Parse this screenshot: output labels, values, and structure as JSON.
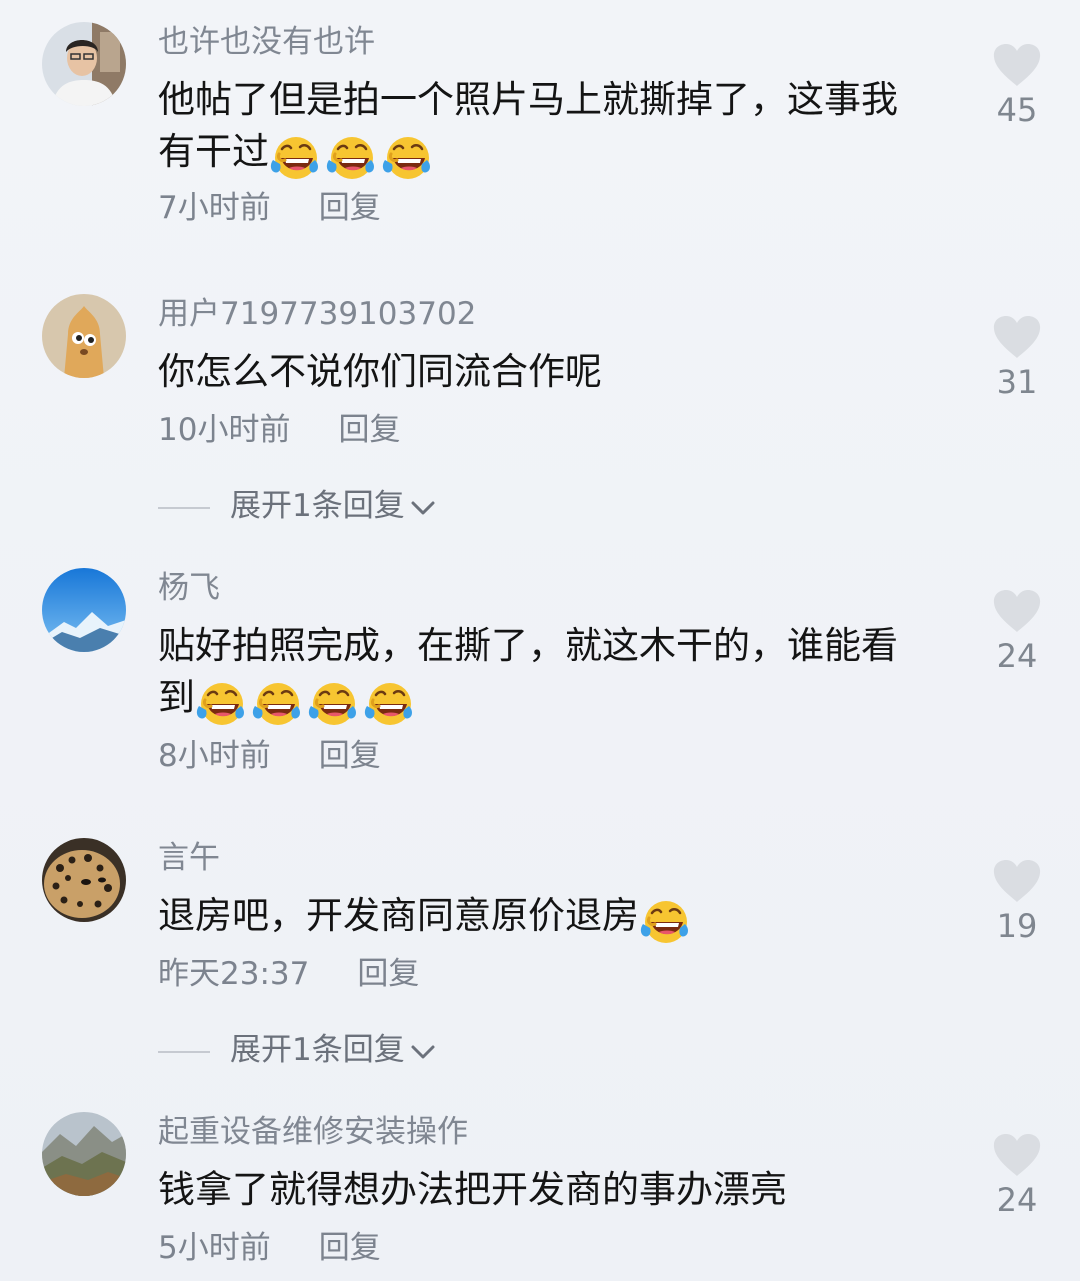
{
  "comments": [
    {
      "username": "也许也没有也许",
      "text_lines": [
        "他帖了但是拍一个照片马上就撕掉了，这事我",
        "有干过"
      ],
      "emoji_count": 3,
      "time": "7小时前",
      "reply_label": "回复",
      "likes": "45",
      "avatar_icon": "person-photo-avatar",
      "emoji_icon": "laughing-tears-emoji"
    },
    {
      "username": "用户7197739103702",
      "text_lines": [
        "你怎么不说你们同流合作呢"
      ],
      "emoji_count": 0,
      "time": "10小时前",
      "reply_label": "回复",
      "likes": "31",
      "expand_label": "展开1条回复",
      "avatar_icon": "cartoon-character-avatar"
    },
    {
      "username": "杨飞",
      "text_lines": [
        "贴好拍照完成，在撕了，就这木干的，谁能看",
        "到"
      ],
      "emoji_count": 4,
      "time": "8小时前",
      "reply_label": "回复",
      "likes": "24",
      "avatar_icon": "snow-mountain-avatar",
      "emoji_icon": "laughing-tears-emoji"
    },
    {
      "username": "言午",
      "text_lines": [
        "退房吧，开发商同意原价退房"
      ],
      "emoji_count": 1,
      "time": "昨天23:37",
      "reply_label": "回复",
      "likes": "19",
      "expand_label": "展开1条回复",
      "avatar_icon": "leopard-avatar",
      "emoji_icon": "laughing-tears-emoji"
    },
    {
      "username": "起重设备维修安装操作",
      "text_lines": [
        "钱拿了就得想办法把开发商的事办漂亮"
      ],
      "emoji_count": 0,
      "time": "5小时前",
      "reply_label": "回复",
      "likes": "24",
      "avatar_icon": "mountain-landscape-avatar"
    }
  ],
  "colors": {
    "background": "#f0f2f6",
    "username": "#808792",
    "text": "#141414",
    "meta": "#7c838e",
    "heart": "#dadde2"
  },
  "icons": {
    "like": "heart-icon",
    "expand": "chevron-down-icon"
  }
}
